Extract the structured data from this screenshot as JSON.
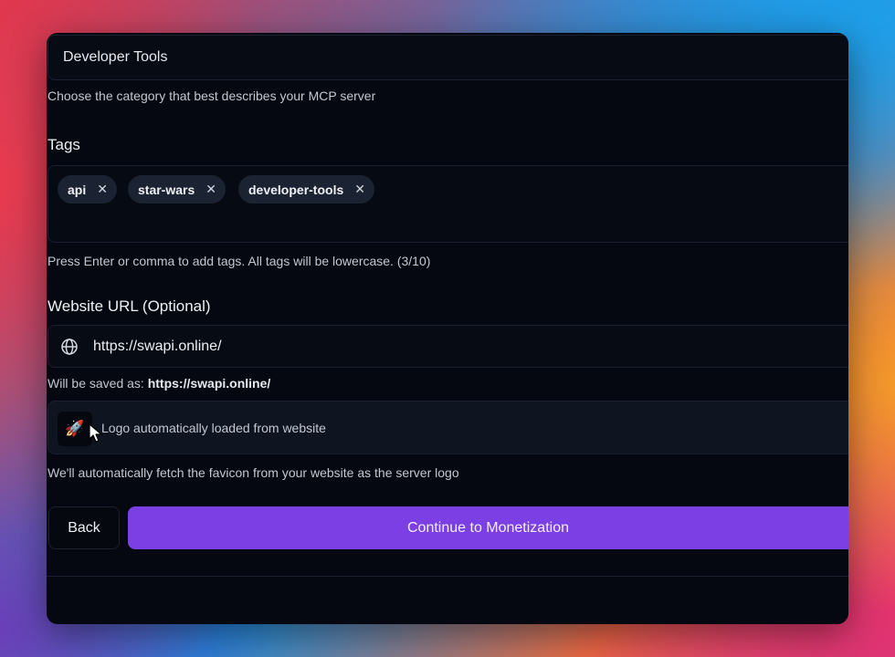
{
  "category": {
    "selected": "Developer Tools",
    "hint": "Choose the category that best describes your MCP server"
  },
  "tags": {
    "label": "Tags",
    "items": [
      {
        "label": "api",
        "remove": "✕"
      },
      {
        "label": "star-wars",
        "remove": "✕"
      },
      {
        "label": "developer-tools",
        "remove": "✕"
      }
    ],
    "hint": "Press Enter or comma to add tags. All tags will be lowercase. (3/10)"
  },
  "website": {
    "label": "Website URL (Optional)",
    "icon": "globe-icon",
    "value": "https://swapi.online/",
    "saved_prefix": "Will be saved as:",
    "saved_value": "https://swapi.online/"
  },
  "logo": {
    "icon": "rocket-icon",
    "glyph": "🚀",
    "text": "Logo automatically loaded from website",
    "hint": "We'll automatically fetch the favicon from your website as the server logo"
  },
  "actions": {
    "back": "Back",
    "continue": "Continue to Monetization"
  },
  "colors": {
    "accent": "#7b3fe4",
    "panel": "#050810"
  }
}
